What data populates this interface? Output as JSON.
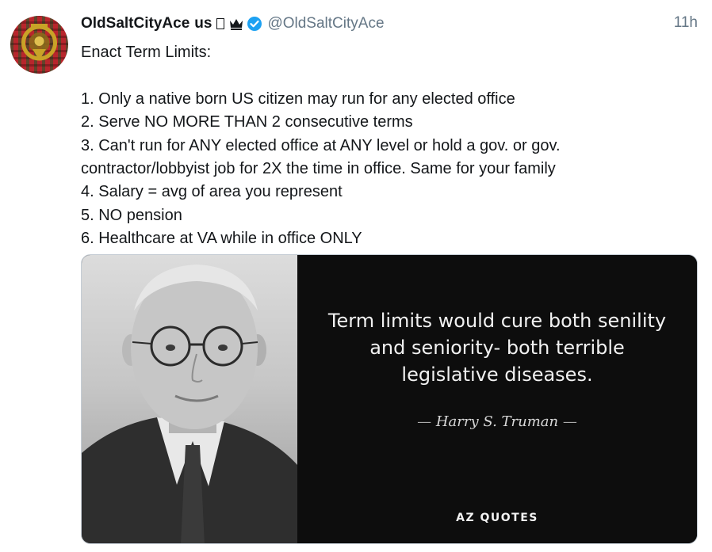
{
  "user": {
    "display_name": "OldSaltCityAce",
    "name_suffix": "us",
    "handle": "@OldSaltCityAce",
    "timestamp": "11h",
    "avatar_icon": "tartan-clan-crest-icon",
    "verified_color": "#1da1f2"
  },
  "tweet": {
    "heading": "Enact Term Limits:",
    "lines": [
      "1. Only a native born US citizen may run for any elected office",
      "2. Serve NO MORE THAN 2 consecutive terms",
      "3. Can't run for ANY elected office at ANY level or hold a gov. or gov.",
      "contractor/lobbyist job for 2X the time in office. Same for your family",
      "4. Salary = avg of area you represent",
      "5. NO pension",
      "6. Healthcare at VA while in office ONLY"
    ]
  },
  "media": {
    "quote_lines": [
      "Term limits would cure both senility",
      "and seniority- both terrible",
      "legislative diseases."
    ],
    "attribution": "Harry S. Truman",
    "attribution_dash": "—",
    "watermark": "AZ QUOTES"
  }
}
